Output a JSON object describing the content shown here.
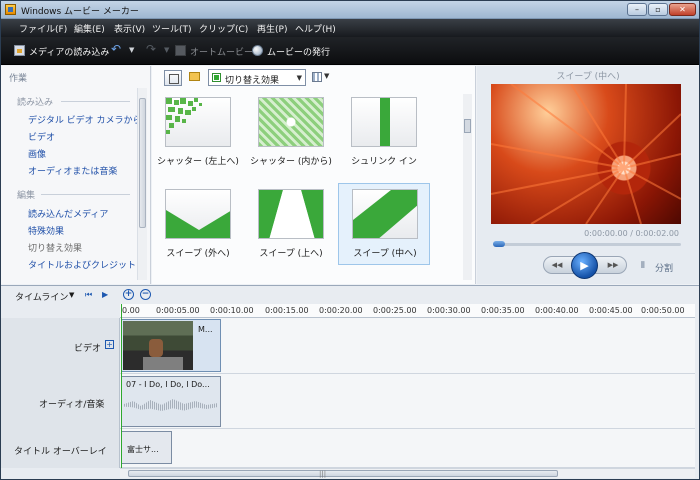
{
  "window": {
    "title": "Windows ムービー メーカー"
  },
  "menu": [
    "ファイル(F)",
    "編集(E)",
    "表示(V)",
    "ツール(T)",
    "クリップ(C)",
    "再生(P)",
    "ヘルプ(H)"
  ],
  "toolbar": {
    "import": "メディアの読み込み",
    "auto_movie": "オートムービー",
    "publish": "ムービーの発行"
  },
  "tasks": {
    "title": "作業",
    "sections": [
      {
        "heading": "読み込み",
        "items": [
          "デジタル ビデオ カメラから",
          "ビデオ",
          "画像",
          "オーディオまたは音楽"
        ]
      },
      {
        "heading": "編集",
        "items": [
          "読み込んだメディア",
          "特殊効果",
          "切り替え効果",
          "タイトルおよびクレジット"
        ]
      }
    ]
  },
  "effects": {
    "dropdown": "切り替え効果",
    "tiles": [
      {
        "label": "シャッター (左上へ)",
        "selected": false
      },
      {
        "label": "シャッター (内から)",
        "selected": false
      },
      {
        "label": "シュリンク イン",
        "selected": false
      },
      {
        "label": "スイープ (外へ)",
        "selected": false
      },
      {
        "label": "スイープ (上へ)",
        "selected": false
      },
      {
        "label": "スイープ (中へ)",
        "selected": true
      }
    ]
  },
  "preview": {
    "title": "スイープ (中へ)",
    "time": "0:00:00.00 / 0:00:02.00",
    "split_label": "分割"
  },
  "timeline": {
    "label": "タイムライン",
    "ticks": [
      "0.00",
      "0:00:05.00",
      "0:00:10.00",
      "0:00:15.00",
      "0:00:20.00",
      "0:00:25.00",
      "0:00:30.00",
      "0:00:35.00",
      "0:00:40.00",
      "0:00:45.00",
      "0:00:50.00"
    ],
    "tracks": {
      "video": "ビデオ",
      "audio": "オーディオ/音楽",
      "title": "タイトル オーバーレイ"
    },
    "clips": {
      "video": "M...",
      "audio": "07 - I Do, I Do, I Do...",
      "title": "富士サ..."
    }
  },
  "colors": {
    "menubar": "#171a1e",
    "link": "#1f4fa8",
    "selection": "#e5f1fc",
    "playhead": "#2ea82e"
  }
}
